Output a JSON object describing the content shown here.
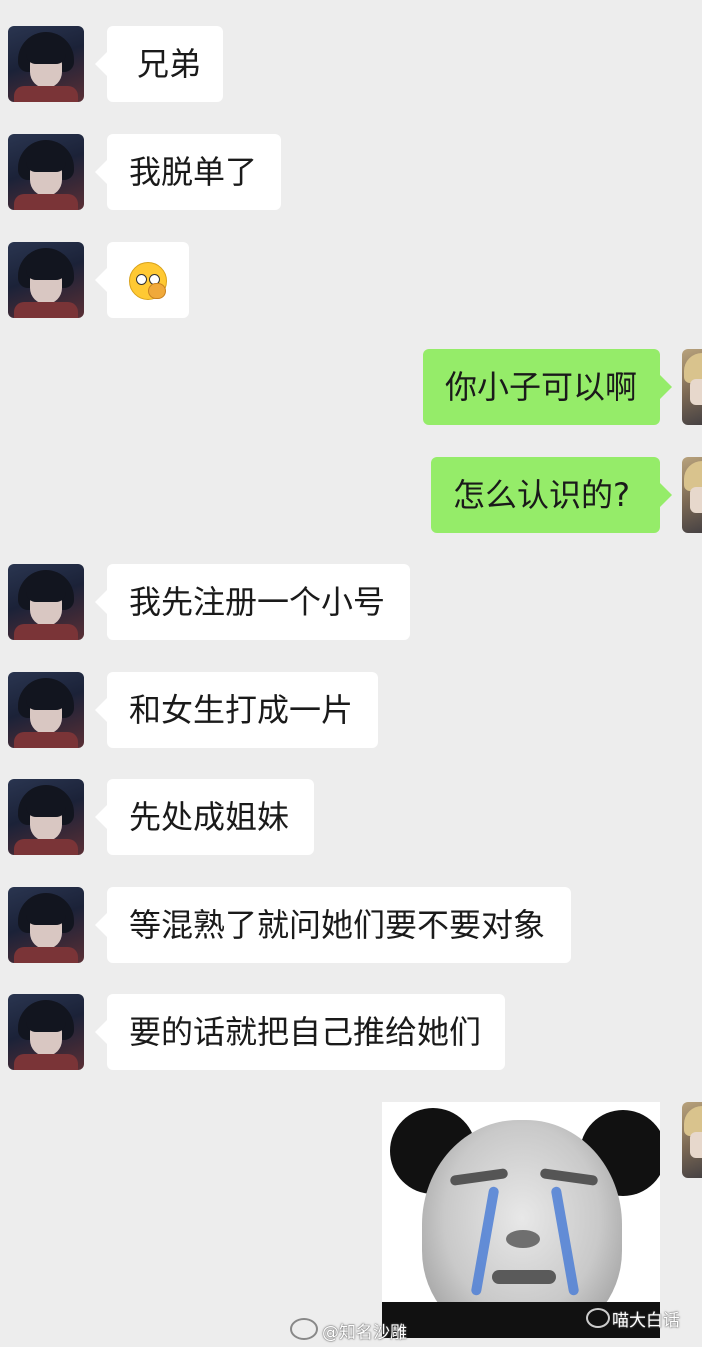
{
  "messages": [
    {
      "side": "left",
      "text": "兄弟"
    },
    {
      "side": "left",
      "text": "我脱单了"
    },
    {
      "side": "left",
      "emoji": "thinking-okay-emoji"
    },
    {
      "side": "right",
      "text": "你小子可以啊"
    },
    {
      "side": "right",
      "text": "怎么认识的?"
    },
    {
      "side": "left",
      "text": "我先注册一个小号"
    },
    {
      "side": "left",
      "text": "和女生打成一片"
    },
    {
      "side": "left",
      "text": "先处成姐妹"
    },
    {
      "side": "left",
      "text": "等混熟了就问她们要不要对象"
    },
    {
      "side": "left",
      "text": "要的话就把自己推给她们"
    },
    {
      "side": "right",
      "sticker": "crying-panda-meme"
    }
  ],
  "watermarks": {
    "weibo": "@知名沙雕",
    "wechat": "喵大白话"
  },
  "colors": {
    "background": "#ededed",
    "incoming_bubble": "#ffffff",
    "outgoing_bubble": "#95ec69",
    "tear": "#4d7fd6"
  }
}
